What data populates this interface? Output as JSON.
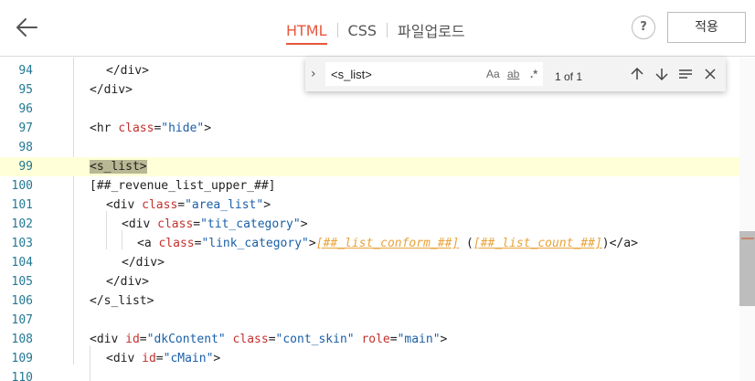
{
  "header": {
    "tabs": [
      {
        "label": "HTML",
        "active": true
      },
      {
        "label": "CSS",
        "active": false
      },
      {
        "label": "파일업로드",
        "active": false
      }
    ],
    "help_label": "?",
    "apply_label": "적용"
  },
  "find": {
    "value": "<s_list>",
    "options": [
      "Aa",
      "ab",
      ".*"
    ],
    "count": "1 of 1"
  },
  "editor": {
    "lines": [
      {
        "num": "94"
      },
      {
        "num": "95"
      },
      {
        "num": "96"
      },
      {
        "num": "97"
      },
      {
        "num": "98"
      },
      {
        "num": "99"
      },
      {
        "num": "100"
      },
      {
        "num": "101"
      },
      {
        "num": "102"
      },
      {
        "num": "103"
      },
      {
        "num": "104"
      },
      {
        "num": "105"
      },
      {
        "num": "106"
      },
      {
        "num": "107"
      },
      {
        "num": "108"
      },
      {
        "num": "109"
      },
      {
        "num": "110"
      }
    ],
    "code": {
      "l94": "</div>",
      "l95": "</div>",
      "l97_tag": "<hr ",
      "l97_attr": "class",
      "l97_eq": "=",
      "l97_str": "\"hide\"",
      "l97_end": ">",
      "l99": "<s_list>",
      "l100": "[##_revenue_list_upper_##]",
      "l101_tag": "<div ",
      "l101_attr": "class",
      "l101_str": "\"area_list\"",
      "l102_tag": "<div ",
      "l102_attr": "class",
      "l102_str": "\"tit_category\"",
      "l103_tag": "<a ",
      "l103_attr": "class",
      "l103_str": "\"link_category\"",
      "l103_tpl1": "[##_list_conform_##]",
      "l103_mid": " (",
      "l103_tpl2": "[##_list_count_##]",
      "l103_end": ")</a>",
      "l104": "</div>",
      "l105": "</div>",
      "l106": "</s_list>",
      "l108_tag": "<div ",
      "l108_a1": "id",
      "l108_s1": "\"dkContent\"",
      "l108_a2": "class",
      "l108_s2": "\"cont_skin\"",
      "l108_a3": "role",
      "l108_s3": "\"main\"",
      "l109_tag": "<div ",
      "l109_a1": "id",
      "l109_s1": "\"cMain\""
    }
  },
  "colors": {
    "accent": "#e9573d",
    "line_number": "#237893",
    "attribute": "#c4312e",
    "string": "#1a5fa8",
    "template_var": "#e8a33a",
    "highlight_line": "#ffffd8"
  }
}
